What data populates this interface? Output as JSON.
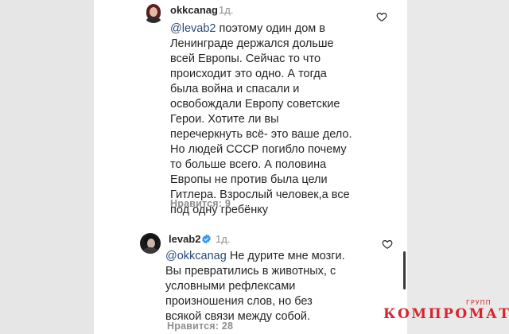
{
  "comments": [
    {
      "username": "okkcanag",
      "time": "1д.",
      "mention": "@levab2",
      "text": " поэтому один дом в\nЛенинграде держался дольше\nвсей Европы. Сейчас то что\nпроисходит это одно. А тогда\nбыла война и спасали и\nосвобождали Европу советские\nГерои. Хотите ли вы\nперечеркнуть всё- это ваше дело.\nНо людей СССР погибло почему\nто больше всего. А половина\nЕвропы не против была цели\nГитлера. Взрослый человек,а все\nпод одну гребёнку",
      "likes": "Нравится: 9"
    },
    {
      "username": "levab2",
      "time": "1д.",
      "mention": "@okkcanag",
      "text": " Не дурите мне мозги.\nВы превратились в животных, с\nусловными рефлексами\nпроизношения слов, но без\nвсякой связи между собой.",
      "likes": "Нравится: 28"
    }
  ],
  "watermark": {
    "main": "КОМПРОМАТ",
    "sub": "ГРУПП"
  },
  "colors": {
    "verified": "#3897f0",
    "watermark": "#d9232d",
    "mention": "#2a4a7a"
  }
}
